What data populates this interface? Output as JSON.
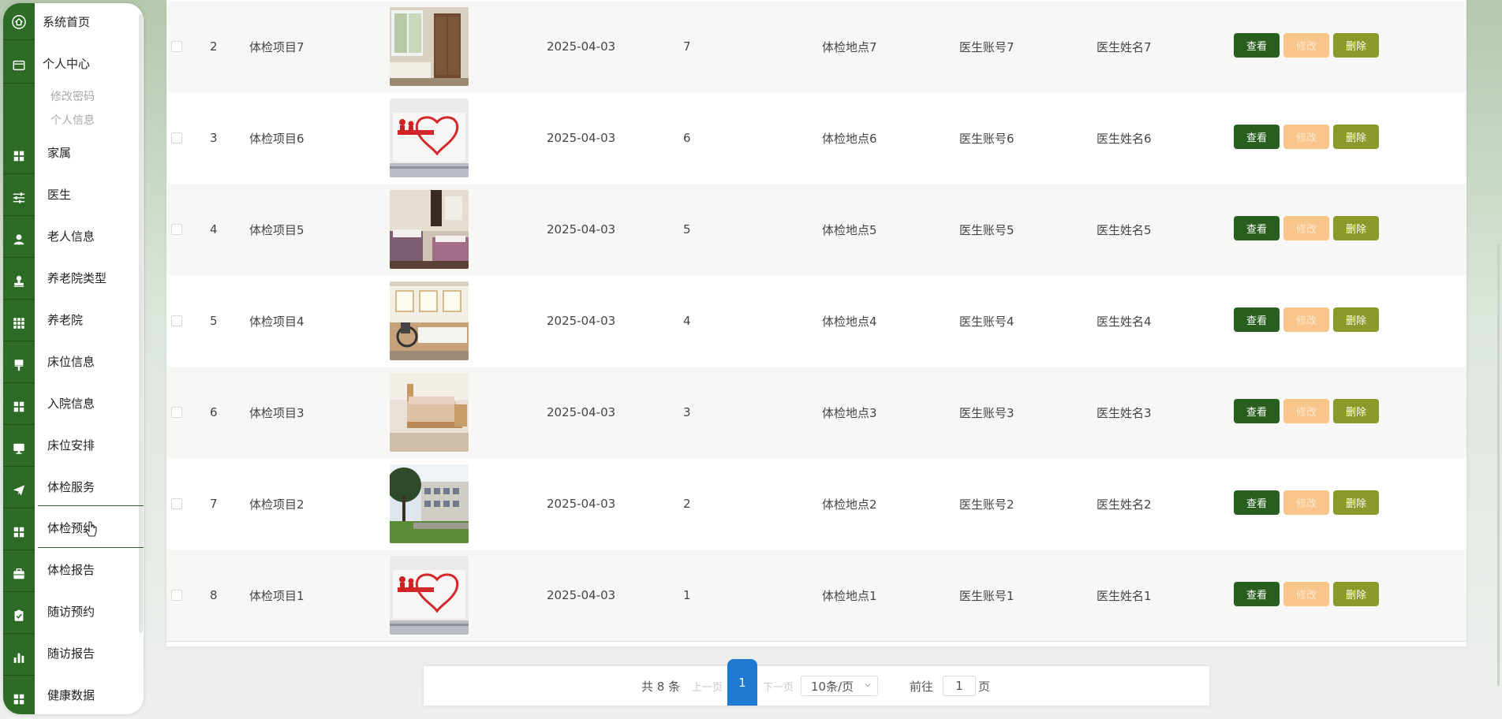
{
  "sidebar": {
    "items": [
      {
        "label": "系统首页",
        "icon": "home-icon"
      },
      {
        "label": "个人中心",
        "icon": "card-icon"
      },
      {
        "label": "家属",
        "icon": "grid-icon"
      },
      {
        "label": "医生",
        "icon": "sliders-icon"
      },
      {
        "label": "老人信息",
        "icon": "user-icon"
      },
      {
        "label": "养老院类型",
        "icon": "stamp-icon"
      },
      {
        "label": "养老院",
        "icon": "apps-icon"
      },
      {
        "label": "床位信息",
        "icon": "brush-icon"
      },
      {
        "label": "入院信息",
        "icon": "grid-icon"
      },
      {
        "label": "床位安排",
        "icon": "monitor-icon"
      },
      {
        "label": "体检服务",
        "icon": "send-icon"
      },
      {
        "label": "体检预约",
        "icon": "grid-icon"
      },
      {
        "label": "体检报告",
        "icon": "briefcase-icon"
      },
      {
        "label": "随访预约",
        "icon": "clipboard-check-icon"
      },
      {
        "label": "随访报告",
        "icon": "bar-chart-icon"
      },
      {
        "label": "健康数据",
        "icon": "grid-icon"
      }
    ],
    "personal_children": [
      "修改密码",
      "个人信息"
    ],
    "active": "体检预约"
  },
  "table": {
    "rows": [
      {
        "index": "2",
        "name": "体检项目7",
        "date": "2025-04-03",
        "count": "7",
        "location": "体检地点7",
        "doctor_account": "医生账号7",
        "doctor_name": "医生姓名7",
        "image": "bedroom-photo"
      },
      {
        "index": "3",
        "name": "体检项目6",
        "date": "2025-04-03",
        "count": "6",
        "location": "体检地点6",
        "doctor_account": "医生账号6",
        "doctor_name": "医生姓名6",
        "image": "poster-photo"
      },
      {
        "index": "4",
        "name": "体检项目5",
        "date": "2025-04-03",
        "count": "5",
        "location": "体检地点5",
        "doctor_account": "医生账号5",
        "doctor_name": "医生姓名5",
        "image": "twin-bed-photo"
      },
      {
        "index": "5",
        "name": "体检项目4",
        "date": "2025-04-03",
        "count": "4",
        "location": "体检地点4",
        "doctor_account": "医生账号4",
        "doctor_name": "医生姓名4",
        "image": "ward-photo"
      },
      {
        "index": "6",
        "name": "体检项目3",
        "date": "2025-04-03",
        "count": "3",
        "location": "体检地点3",
        "doctor_account": "医生账号3",
        "doctor_name": "医生姓名3",
        "image": "wooden-bed-photo"
      },
      {
        "index": "7",
        "name": "体检项目2",
        "date": "2025-04-03",
        "count": "2",
        "location": "体检地点2",
        "doctor_account": "医生账号2",
        "doctor_name": "医生姓名2",
        "image": "building-photo"
      },
      {
        "index": "8",
        "name": "体检项目1",
        "date": "2025-04-03",
        "count": "1",
        "location": "体检地点1",
        "doctor_account": "医生账号1",
        "doctor_name": "医生姓名1",
        "image": "poster-photo"
      }
    ],
    "actions": {
      "view": "查看",
      "edit": "修改",
      "delete": "删除"
    }
  },
  "pagination": {
    "total": "共 8 条",
    "prev": "上一页",
    "current_page": "1",
    "next": "下一页",
    "page_size": "10条/页",
    "goto_label": "前往",
    "goto_value": "1",
    "goto_suffix": "页"
  },
  "colors": {
    "primary_green": "#2c6a26",
    "view_button": "#285f1f",
    "edit_button": "#f8c58a",
    "delete_button": "#8c9a2b",
    "active_page": "#1f7ad4"
  }
}
